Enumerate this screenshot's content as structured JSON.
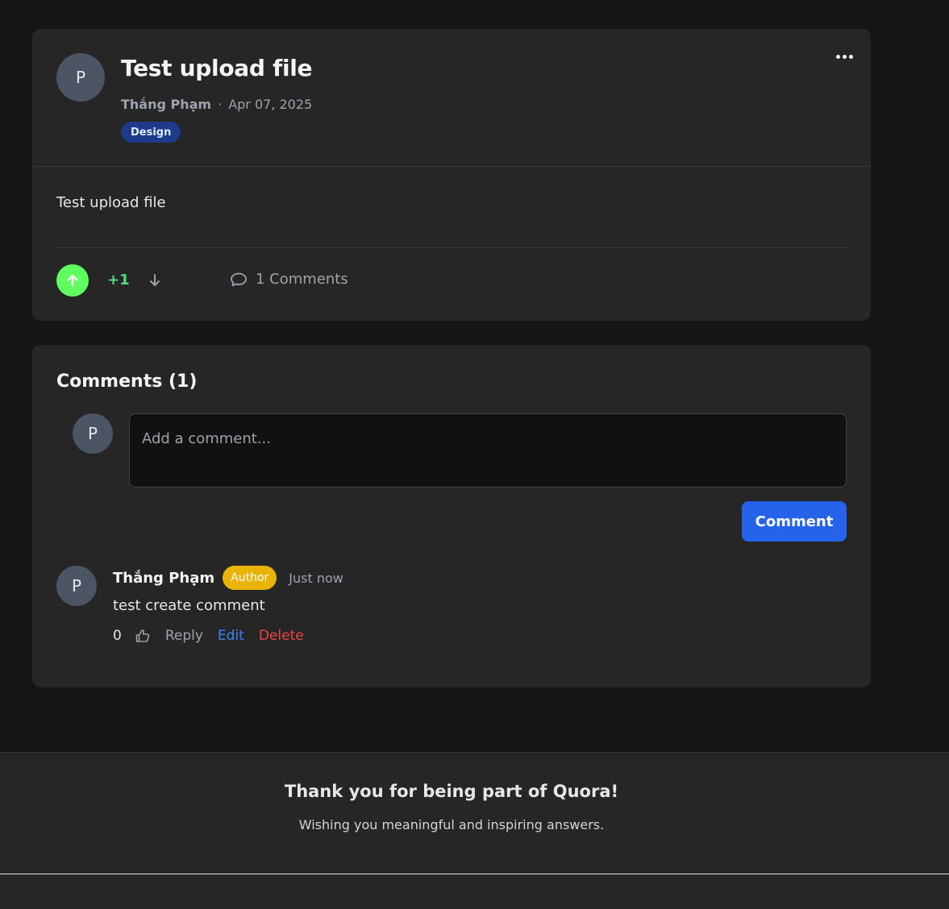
{
  "post": {
    "avatar_initial": "P",
    "title": "Test upload file",
    "author": "Thắng Phạm",
    "separator": "·",
    "date": "Apr 07, 2025",
    "tag": "Design",
    "body": "Test upload file",
    "vote_count": "+1",
    "comments_link": "1 Comments"
  },
  "comments": {
    "heading": "Comments (1)",
    "composer": {
      "avatar_initial": "P",
      "placeholder": "Add a comment...",
      "submit_label": "Comment"
    },
    "items": [
      {
        "avatar_initial": "P",
        "author": "Thắng Phạm",
        "badge": "Author",
        "time": "Just now",
        "text": "test create comment",
        "likes": "0",
        "reply_label": "Reply",
        "edit_label": "Edit",
        "delete_label": "Delete"
      }
    ]
  },
  "footer": {
    "title": "Thank you for being part of Quora!",
    "subtitle": "Wishing you meaningful and inspiring answers."
  },
  "colors": {
    "page_bg": "#151515",
    "card_bg": "#262626",
    "upvote_active": "#5eff5e",
    "vote_count": "#4ade80",
    "tag_bg": "#1e3a8a",
    "primary_button": "#2563eb",
    "author_badge": "#eab308",
    "edit_link": "#3b82f6",
    "delete_link": "#ef4444"
  },
  "icons": {
    "more": "more-horizontal-icon",
    "upvote": "arrow-up-icon",
    "downvote": "arrow-down-icon",
    "comments": "chat-bubble-icon",
    "like": "thumbs-up-icon"
  }
}
